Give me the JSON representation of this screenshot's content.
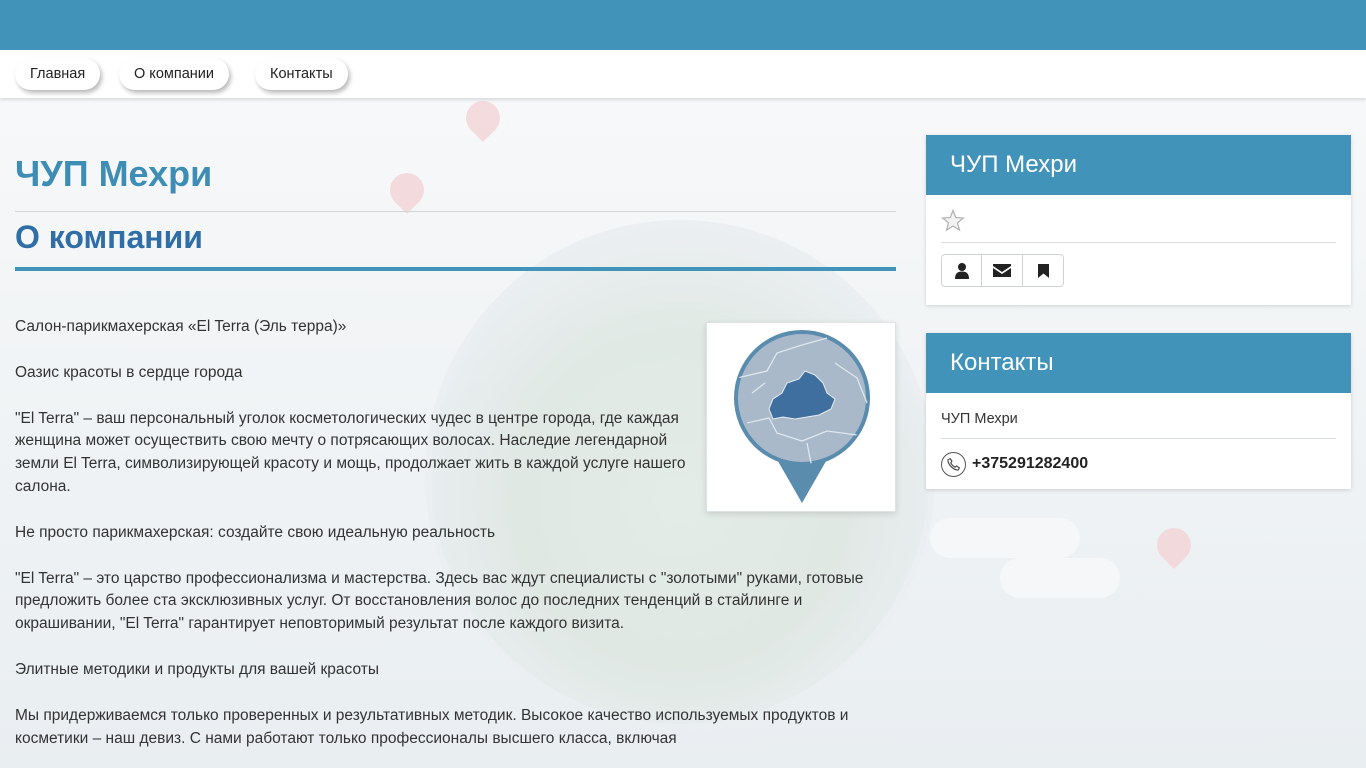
{
  "nav": {
    "items": [
      {
        "label": "Главная"
      },
      {
        "label": "О компании"
      },
      {
        "label": "Контакты"
      }
    ]
  },
  "main": {
    "company_title": "ЧУП Мехри",
    "section_title": "О компании",
    "paragraphs": [
      "Салон-парикмахерская «El Terra (Эль терра)»",
      "Оазис красоты в сердце города",
      "\"El Terra\" – ваш персональный уголок косметологических чудес в центре города, где каждая женщина может осуществить свою мечту о потрясающих волосах. Наследие легендарной земли El Terra, символизирующей красоту и мощь, продолжает жить в каждой услуге нашего салона.",
      "Не просто парикмахерская: создайте свою идеальную реальность",
      "\"El Terra\" – это царство профессионализма и мастерства. Здесь вас ждут специалисты с \"золотыми\" руками, готовые предложить более ста эксклюзивных услуг. От восстановления волос до последних тенденций в стайлинге и окрашивании, \"El Terra\" гарантирует неповторимый результат после каждого визита.",
      "Элитные методики и продукты для вашей красоты",
      "Мы придерживаемся только проверенных и результативных методик. Высокое качество используемых продуктов и косметики – наш девиз. С нами работают только профессионалы высшего класса, включая"
    ],
    "map_icon": "belarus-map-pin-icon"
  },
  "sidebar": {
    "company_card": {
      "title": "ЧУП Мехри",
      "rating_icon": "star-outline-icon",
      "action_icons": [
        "user-icon",
        "envelope-icon",
        "bookmark-icon"
      ]
    },
    "contacts_card": {
      "title": "Контакты",
      "company_name": "ЧУП Мехри",
      "phone": "+375291282400",
      "phone_icon": "phone-icon"
    }
  },
  "colors": {
    "brand": "#4193b9",
    "title": "#3e8db5",
    "section_title": "#2f6ea6",
    "map_fill": "#9aaec3",
    "map_highlight": "#3f6f9f"
  }
}
